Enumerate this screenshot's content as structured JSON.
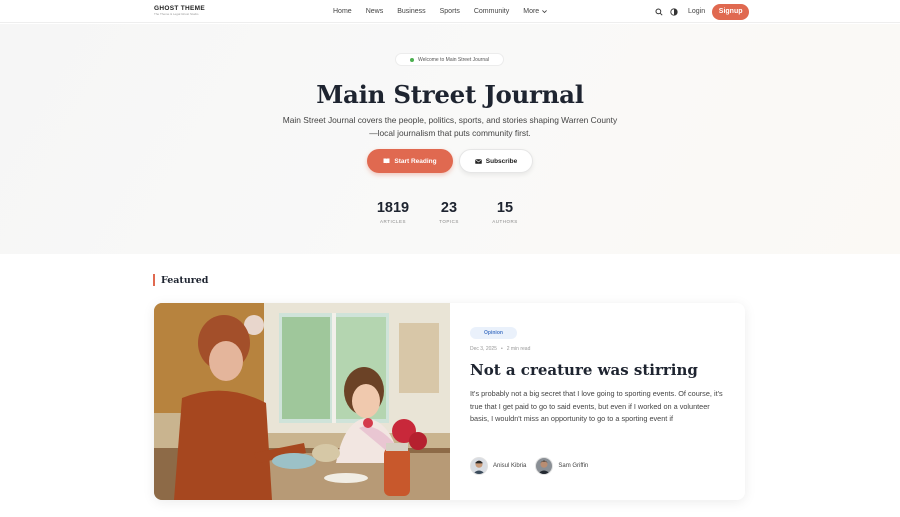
{
  "nav": {
    "logo": "GHOST THEME",
    "logo_tagline": "The Theme & Legal Ghost Studio",
    "links": [
      "Home",
      "News",
      "Business",
      "Sports",
      "Community"
    ],
    "more_label": "More",
    "login_label": "Login",
    "signup_label": "Signup",
    "icons": [
      "search-icon",
      "theme-toggle-icon",
      "chevron-down-icon"
    ]
  },
  "hero": {
    "welcome": "Welcome to Main Street Journal",
    "title": "Main Street Journal",
    "description": "Main Street Journal covers the people, politics, sports, and stories shaping Warren County—local journalism that puts community first.",
    "primary_button": "Start Reading",
    "secondary_button": "Subscribe",
    "stats": [
      {
        "value": "1819",
        "label": "ARTICLES"
      },
      {
        "value": "23",
        "label": "TOPICS"
      },
      {
        "value": "15",
        "label": "AUTHORS"
      }
    ]
  },
  "featured": {
    "section_title": "Featured",
    "post": {
      "tag": "Opinion",
      "date": "Dec 3, 2025",
      "separator": "•",
      "read_time": "2 min read",
      "title": "Not a creature was stirring",
      "excerpt": "It's probably not a big secret that I love going to sporting events. Of course, it's true that I get paid to go to said events, but even if I worked on a volunteer basis, I wouldn't miss an opportunity to go to a sporting event if",
      "authors": [
        "Anisul Kibria",
        "Sam Griffin"
      ]
    }
  },
  "colors": {
    "accent": "#e06950",
    "tag_bg": "#eaf1fb",
    "tag_text": "#4a79c7",
    "heading": "#1e2430"
  }
}
